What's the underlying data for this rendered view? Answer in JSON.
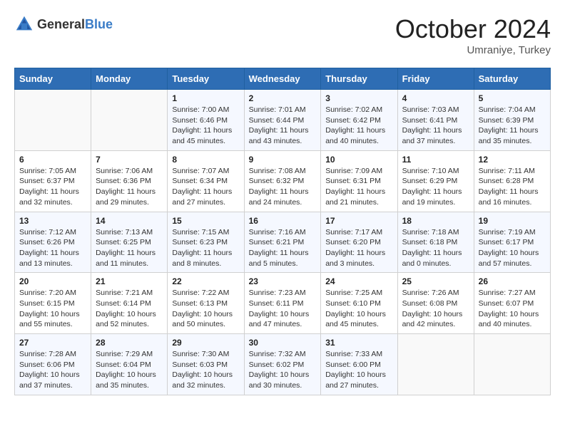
{
  "header": {
    "logo_general": "General",
    "logo_blue": "Blue",
    "month": "October 2024",
    "location": "Umraniye, Turkey"
  },
  "weekdays": [
    "Sunday",
    "Monday",
    "Tuesday",
    "Wednesday",
    "Thursday",
    "Friday",
    "Saturday"
  ],
  "weeks": [
    [
      {
        "day": "",
        "sunrise": "",
        "sunset": "",
        "daylight": ""
      },
      {
        "day": "",
        "sunrise": "",
        "sunset": "",
        "daylight": ""
      },
      {
        "day": "1",
        "sunrise": "Sunrise: 7:00 AM",
        "sunset": "Sunset: 6:46 PM",
        "daylight": "Daylight: 11 hours and 45 minutes."
      },
      {
        "day": "2",
        "sunrise": "Sunrise: 7:01 AM",
        "sunset": "Sunset: 6:44 PM",
        "daylight": "Daylight: 11 hours and 43 minutes."
      },
      {
        "day": "3",
        "sunrise": "Sunrise: 7:02 AM",
        "sunset": "Sunset: 6:42 PM",
        "daylight": "Daylight: 11 hours and 40 minutes."
      },
      {
        "day": "4",
        "sunrise": "Sunrise: 7:03 AM",
        "sunset": "Sunset: 6:41 PM",
        "daylight": "Daylight: 11 hours and 37 minutes."
      },
      {
        "day": "5",
        "sunrise": "Sunrise: 7:04 AM",
        "sunset": "Sunset: 6:39 PM",
        "daylight": "Daylight: 11 hours and 35 minutes."
      }
    ],
    [
      {
        "day": "6",
        "sunrise": "Sunrise: 7:05 AM",
        "sunset": "Sunset: 6:37 PM",
        "daylight": "Daylight: 11 hours and 32 minutes."
      },
      {
        "day": "7",
        "sunrise": "Sunrise: 7:06 AM",
        "sunset": "Sunset: 6:36 PM",
        "daylight": "Daylight: 11 hours and 29 minutes."
      },
      {
        "day": "8",
        "sunrise": "Sunrise: 7:07 AM",
        "sunset": "Sunset: 6:34 PM",
        "daylight": "Daylight: 11 hours and 27 minutes."
      },
      {
        "day": "9",
        "sunrise": "Sunrise: 7:08 AM",
        "sunset": "Sunset: 6:32 PM",
        "daylight": "Daylight: 11 hours and 24 minutes."
      },
      {
        "day": "10",
        "sunrise": "Sunrise: 7:09 AM",
        "sunset": "Sunset: 6:31 PM",
        "daylight": "Daylight: 11 hours and 21 minutes."
      },
      {
        "day": "11",
        "sunrise": "Sunrise: 7:10 AM",
        "sunset": "Sunset: 6:29 PM",
        "daylight": "Daylight: 11 hours and 19 minutes."
      },
      {
        "day": "12",
        "sunrise": "Sunrise: 7:11 AM",
        "sunset": "Sunset: 6:28 PM",
        "daylight": "Daylight: 11 hours and 16 minutes."
      }
    ],
    [
      {
        "day": "13",
        "sunrise": "Sunrise: 7:12 AM",
        "sunset": "Sunset: 6:26 PM",
        "daylight": "Daylight: 11 hours and 13 minutes."
      },
      {
        "day": "14",
        "sunrise": "Sunrise: 7:13 AM",
        "sunset": "Sunset: 6:25 PM",
        "daylight": "Daylight: 11 hours and 11 minutes."
      },
      {
        "day": "15",
        "sunrise": "Sunrise: 7:15 AM",
        "sunset": "Sunset: 6:23 PM",
        "daylight": "Daylight: 11 hours and 8 minutes."
      },
      {
        "day": "16",
        "sunrise": "Sunrise: 7:16 AM",
        "sunset": "Sunset: 6:21 PM",
        "daylight": "Daylight: 11 hours and 5 minutes."
      },
      {
        "day": "17",
        "sunrise": "Sunrise: 7:17 AM",
        "sunset": "Sunset: 6:20 PM",
        "daylight": "Daylight: 11 hours and 3 minutes."
      },
      {
        "day": "18",
        "sunrise": "Sunrise: 7:18 AM",
        "sunset": "Sunset: 6:18 PM",
        "daylight": "Daylight: 11 hours and 0 minutes."
      },
      {
        "day": "19",
        "sunrise": "Sunrise: 7:19 AM",
        "sunset": "Sunset: 6:17 PM",
        "daylight": "Daylight: 10 hours and 57 minutes."
      }
    ],
    [
      {
        "day": "20",
        "sunrise": "Sunrise: 7:20 AM",
        "sunset": "Sunset: 6:15 PM",
        "daylight": "Daylight: 10 hours and 55 minutes."
      },
      {
        "day": "21",
        "sunrise": "Sunrise: 7:21 AM",
        "sunset": "Sunset: 6:14 PM",
        "daylight": "Daylight: 10 hours and 52 minutes."
      },
      {
        "day": "22",
        "sunrise": "Sunrise: 7:22 AM",
        "sunset": "Sunset: 6:13 PM",
        "daylight": "Daylight: 10 hours and 50 minutes."
      },
      {
        "day": "23",
        "sunrise": "Sunrise: 7:23 AM",
        "sunset": "Sunset: 6:11 PM",
        "daylight": "Daylight: 10 hours and 47 minutes."
      },
      {
        "day": "24",
        "sunrise": "Sunrise: 7:25 AM",
        "sunset": "Sunset: 6:10 PM",
        "daylight": "Daylight: 10 hours and 45 minutes."
      },
      {
        "day": "25",
        "sunrise": "Sunrise: 7:26 AM",
        "sunset": "Sunset: 6:08 PM",
        "daylight": "Daylight: 10 hours and 42 minutes."
      },
      {
        "day": "26",
        "sunrise": "Sunrise: 7:27 AM",
        "sunset": "Sunset: 6:07 PM",
        "daylight": "Daylight: 10 hours and 40 minutes."
      }
    ],
    [
      {
        "day": "27",
        "sunrise": "Sunrise: 7:28 AM",
        "sunset": "Sunset: 6:06 PM",
        "daylight": "Daylight: 10 hours and 37 minutes."
      },
      {
        "day": "28",
        "sunrise": "Sunrise: 7:29 AM",
        "sunset": "Sunset: 6:04 PM",
        "daylight": "Daylight: 10 hours and 35 minutes."
      },
      {
        "day": "29",
        "sunrise": "Sunrise: 7:30 AM",
        "sunset": "Sunset: 6:03 PM",
        "daylight": "Daylight: 10 hours and 32 minutes."
      },
      {
        "day": "30",
        "sunrise": "Sunrise: 7:32 AM",
        "sunset": "Sunset: 6:02 PM",
        "daylight": "Daylight: 10 hours and 30 minutes."
      },
      {
        "day": "31",
        "sunrise": "Sunrise: 7:33 AM",
        "sunset": "Sunset: 6:00 PM",
        "daylight": "Daylight: 10 hours and 27 minutes."
      },
      {
        "day": "",
        "sunrise": "",
        "sunset": "",
        "daylight": ""
      },
      {
        "day": "",
        "sunrise": "",
        "sunset": "",
        "daylight": ""
      }
    ]
  ]
}
